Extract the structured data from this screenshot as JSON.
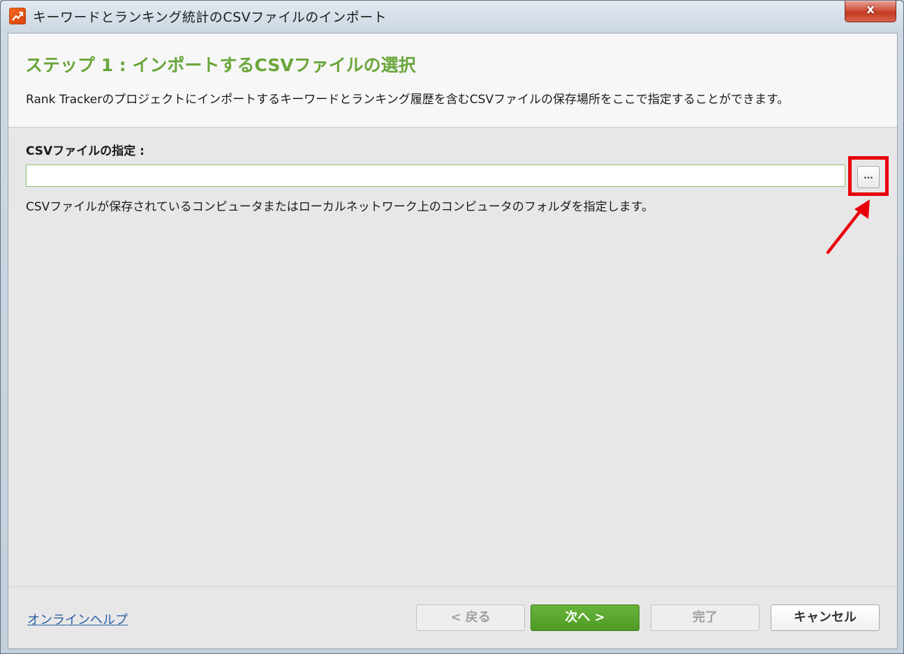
{
  "window": {
    "title": "キーワードとランキング統計のCSVファイルのインポート",
    "close_glyph": "x",
    "icon": "rank-tracker-app-icon"
  },
  "header": {
    "step_title": "ステップ 1 : インポートするCSVファイルの選択",
    "description": "Rank Trackerのプロジェクトにインポートするキーワードとランキング履歴を含むCSVファイルの保存場所をここで指定することができます。"
  },
  "csv_field": {
    "label": "CSVファイルの指定 :",
    "value": "",
    "placeholder": "",
    "browse_label": "...",
    "hint": "CSVファイルが保存されているコンピュータまたはローカルネットワーク上のコンピュータのフォルダを指定します。"
  },
  "footer": {
    "help_link": "オンラインヘルプ",
    "back_button": "< 戻る",
    "next_button": "次へ >",
    "finish_button": "完了",
    "cancel_button": "キャンセル"
  },
  "colors": {
    "accent_green": "#6aa63b",
    "primary_button": "#56a22d",
    "highlight_red": "#e8000c",
    "link_blue": "#2b5fa8"
  }
}
